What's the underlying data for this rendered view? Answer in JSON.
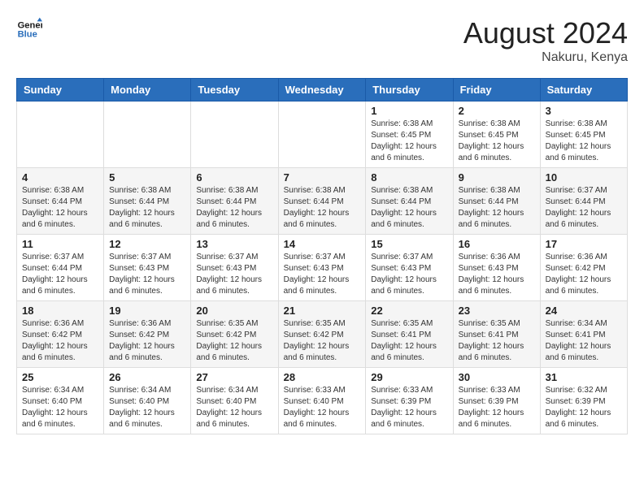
{
  "logo": {
    "line1": "General",
    "line2": "Blue"
  },
  "title": "August 2024",
  "location": "Nakuru, Kenya",
  "days_of_week": [
    "Sunday",
    "Monday",
    "Tuesday",
    "Wednesday",
    "Thursday",
    "Friday",
    "Saturday"
  ],
  "weeks": [
    [
      {
        "day": "",
        "info": ""
      },
      {
        "day": "",
        "info": ""
      },
      {
        "day": "",
        "info": ""
      },
      {
        "day": "",
        "info": ""
      },
      {
        "day": "1",
        "info": "Sunrise: 6:38 AM\nSunset: 6:45 PM\nDaylight: 12 hours\nand 6 minutes."
      },
      {
        "day": "2",
        "info": "Sunrise: 6:38 AM\nSunset: 6:45 PM\nDaylight: 12 hours\nand 6 minutes."
      },
      {
        "day": "3",
        "info": "Sunrise: 6:38 AM\nSunset: 6:45 PM\nDaylight: 12 hours\nand 6 minutes."
      }
    ],
    [
      {
        "day": "4",
        "info": "Sunrise: 6:38 AM\nSunset: 6:44 PM\nDaylight: 12 hours\nand 6 minutes."
      },
      {
        "day": "5",
        "info": "Sunrise: 6:38 AM\nSunset: 6:44 PM\nDaylight: 12 hours\nand 6 minutes."
      },
      {
        "day": "6",
        "info": "Sunrise: 6:38 AM\nSunset: 6:44 PM\nDaylight: 12 hours\nand 6 minutes."
      },
      {
        "day": "7",
        "info": "Sunrise: 6:38 AM\nSunset: 6:44 PM\nDaylight: 12 hours\nand 6 minutes."
      },
      {
        "day": "8",
        "info": "Sunrise: 6:38 AM\nSunset: 6:44 PM\nDaylight: 12 hours\nand 6 minutes."
      },
      {
        "day": "9",
        "info": "Sunrise: 6:38 AM\nSunset: 6:44 PM\nDaylight: 12 hours\nand 6 minutes."
      },
      {
        "day": "10",
        "info": "Sunrise: 6:37 AM\nSunset: 6:44 PM\nDaylight: 12 hours\nand 6 minutes."
      }
    ],
    [
      {
        "day": "11",
        "info": "Sunrise: 6:37 AM\nSunset: 6:44 PM\nDaylight: 12 hours\nand 6 minutes."
      },
      {
        "day": "12",
        "info": "Sunrise: 6:37 AM\nSunset: 6:43 PM\nDaylight: 12 hours\nand 6 minutes."
      },
      {
        "day": "13",
        "info": "Sunrise: 6:37 AM\nSunset: 6:43 PM\nDaylight: 12 hours\nand 6 minutes."
      },
      {
        "day": "14",
        "info": "Sunrise: 6:37 AM\nSunset: 6:43 PM\nDaylight: 12 hours\nand 6 minutes."
      },
      {
        "day": "15",
        "info": "Sunrise: 6:37 AM\nSunset: 6:43 PM\nDaylight: 12 hours\nand 6 minutes."
      },
      {
        "day": "16",
        "info": "Sunrise: 6:36 AM\nSunset: 6:43 PM\nDaylight: 12 hours\nand 6 minutes."
      },
      {
        "day": "17",
        "info": "Sunrise: 6:36 AM\nSunset: 6:42 PM\nDaylight: 12 hours\nand 6 minutes."
      }
    ],
    [
      {
        "day": "18",
        "info": "Sunrise: 6:36 AM\nSunset: 6:42 PM\nDaylight: 12 hours\nand 6 minutes."
      },
      {
        "day": "19",
        "info": "Sunrise: 6:36 AM\nSunset: 6:42 PM\nDaylight: 12 hours\nand 6 minutes."
      },
      {
        "day": "20",
        "info": "Sunrise: 6:35 AM\nSunset: 6:42 PM\nDaylight: 12 hours\nand 6 minutes."
      },
      {
        "day": "21",
        "info": "Sunrise: 6:35 AM\nSunset: 6:42 PM\nDaylight: 12 hours\nand 6 minutes."
      },
      {
        "day": "22",
        "info": "Sunrise: 6:35 AM\nSunset: 6:41 PM\nDaylight: 12 hours\nand 6 minutes."
      },
      {
        "day": "23",
        "info": "Sunrise: 6:35 AM\nSunset: 6:41 PM\nDaylight: 12 hours\nand 6 minutes."
      },
      {
        "day": "24",
        "info": "Sunrise: 6:34 AM\nSunset: 6:41 PM\nDaylight: 12 hours\nand 6 minutes."
      }
    ],
    [
      {
        "day": "25",
        "info": "Sunrise: 6:34 AM\nSunset: 6:40 PM\nDaylight: 12 hours\nand 6 minutes."
      },
      {
        "day": "26",
        "info": "Sunrise: 6:34 AM\nSunset: 6:40 PM\nDaylight: 12 hours\nand 6 minutes."
      },
      {
        "day": "27",
        "info": "Sunrise: 6:34 AM\nSunset: 6:40 PM\nDaylight: 12 hours\nand 6 minutes."
      },
      {
        "day": "28",
        "info": "Sunrise: 6:33 AM\nSunset: 6:40 PM\nDaylight: 12 hours\nand 6 minutes."
      },
      {
        "day": "29",
        "info": "Sunrise: 6:33 AM\nSunset: 6:39 PM\nDaylight: 12 hours\nand 6 minutes."
      },
      {
        "day": "30",
        "info": "Sunrise: 6:33 AM\nSunset: 6:39 PM\nDaylight: 12 hours\nand 6 minutes."
      },
      {
        "day": "31",
        "info": "Sunrise: 6:32 AM\nSunset: 6:39 PM\nDaylight: 12 hours\nand 6 minutes."
      }
    ]
  ]
}
